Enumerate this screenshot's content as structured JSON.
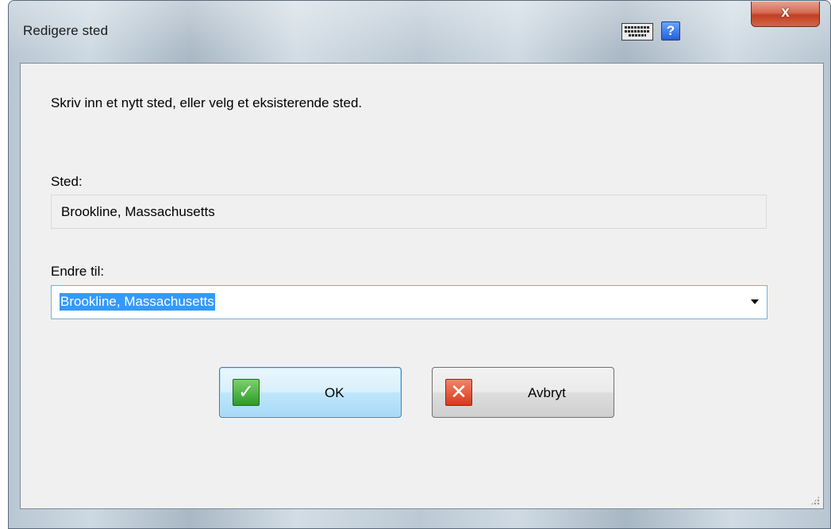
{
  "window": {
    "title": "Redigere sted",
    "close_glyph": "x",
    "help_glyph": "?",
    "icons": [
      "keyboard-icon",
      "help-icon",
      "close-icon"
    ]
  },
  "dialog": {
    "instruction": "Skriv inn et nytt sted, eller velg et eksisterende sted.",
    "current_place": {
      "label": "Sted:",
      "value": "Brookline, Massachusetts"
    },
    "change_to": {
      "label": "Endre til:",
      "value": "Brookline, Massachusetts",
      "selected": true
    }
  },
  "buttons": {
    "ok": {
      "label": "OK",
      "icon": "check-icon",
      "glyph": "✓"
    },
    "cancel": {
      "label": "Avbryt",
      "icon": "x-icon",
      "glyph": "✕"
    }
  },
  "colors": {
    "selection": "#3399ff",
    "ok_icon": "#2f9a2a",
    "cancel_icon": "#d63a1c",
    "close_button": "#c23f23",
    "help_icon": "#2360d6"
  }
}
